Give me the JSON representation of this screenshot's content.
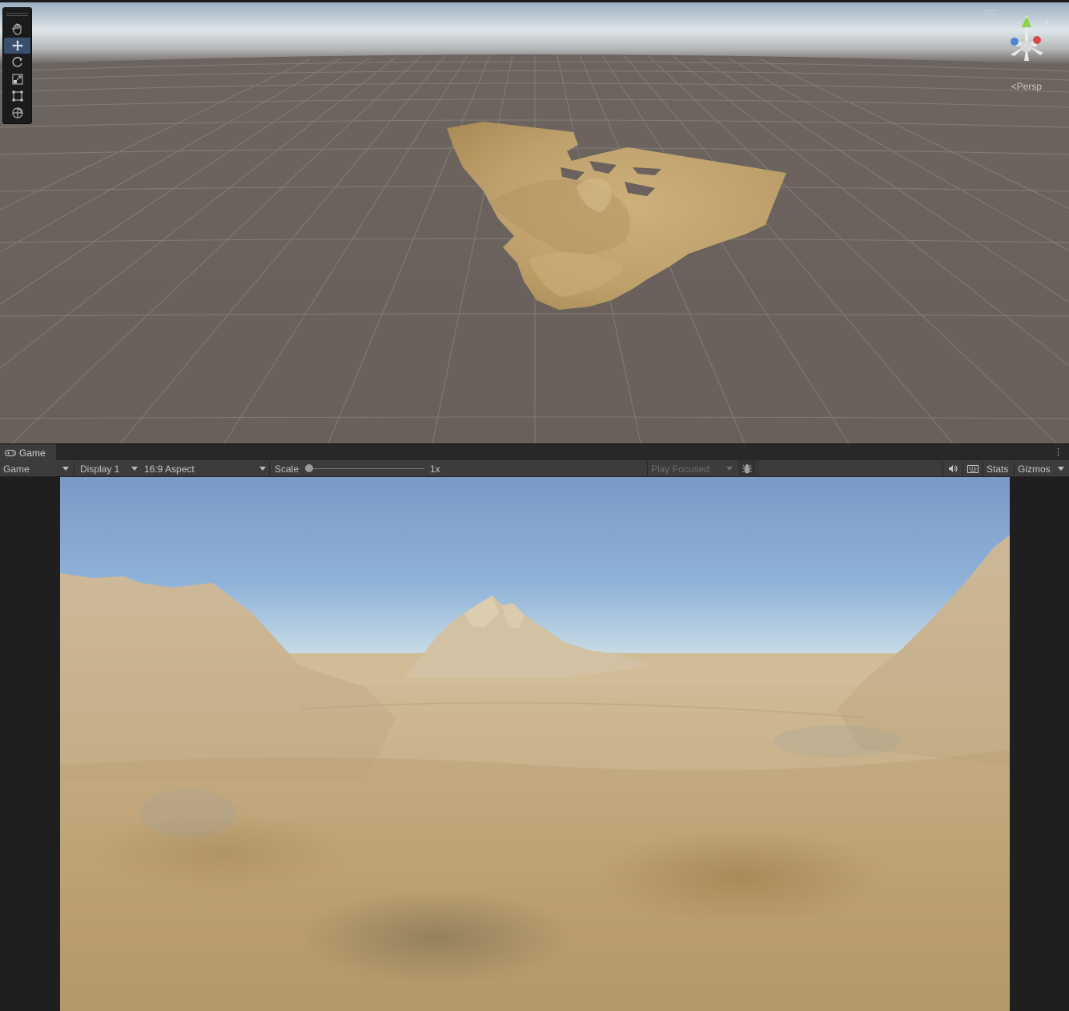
{
  "scene_view": {
    "camera_mode_label": "Persp",
    "tools": [
      {
        "name": "hand-tool",
        "icon": "hand-icon"
      },
      {
        "name": "move-tool",
        "icon": "move-icon",
        "active": true
      },
      {
        "name": "rotate-tool",
        "icon": "rotate-icon"
      },
      {
        "name": "scale-tool",
        "icon": "scale-icon"
      },
      {
        "name": "rect-tool",
        "icon": "rect-icon"
      },
      {
        "name": "transform-tool",
        "icon": "transform-icon"
      }
    ]
  },
  "game_view": {
    "tab_label": "Game",
    "tab_icon": "gamepad-icon",
    "toolbar": {
      "mode_dropdown": "Game",
      "display_dropdown": "Display 1",
      "aspect_dropdown": "16:9 Aspect",
      "scale_label": "Scale",
      "scale_value": "1x",
      "play_mode_dropdown": "Play Focused",
      "bug_icon": "bug-icon",
      "audio_icon": "speaker-icon",
      "keyboard_icon": "keyboard-icon",
      "stats_label": "Stats",
      "gizmos_label": "Gizmos"
    }
  },
  "colors": {
    "editor_bg": "#282828",
    "toolbar_bg": "#3c3c3c",
    "scene_ground": "#6b625d",
    "terrain_sand": "#c8ac74",
    "sky_top": "#7196c7",
    "active_tool": "#3a4f6e"
  }
}
